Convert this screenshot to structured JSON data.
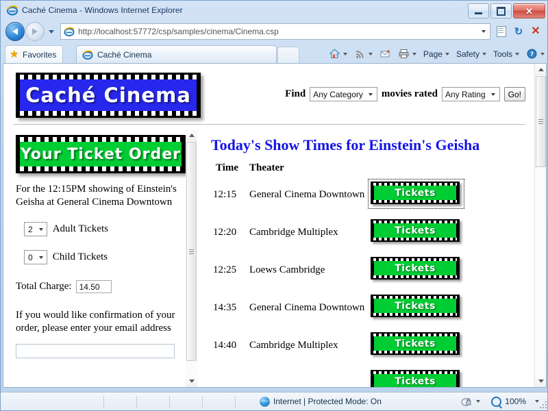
{
  "window": {
    "title": "Caché Cinema - Windows Internet Explorer",
    "minimize_label": "Minimize",
    "maximize_label": "Maximize",
    "close_label": "✕"
  },
  "browser": {
    "back_label": "Back",
    "forward_label": "Forward",
    "recent_pages_label": "Recent Pages",
    "url_scheme": "http://",
    "url_host": "localhost:57772",
    "url_path": "/csp/samples/cinema/Cinema.csp",
    "url_full": "http://localhost:57772/csp/samples/cinema/Cinema.csp",
    "compatibility_label": "Compatibility View",
    "refresh_label": "↻",
    "stop_label": "✕",
    "favorites_label": "Favorites",
    "tab_label": "Caché Cinema",
    "new_tab_label": "New Tab",
    "commands": [
      {
        "label": "Page"
      },
      {
        "label": "Safety"
      },
      {
        "label": "Tools"
      }
    ],
    "home_label": "Home",
    "feeds_label": "Feeds",
    "mail_label": "Read Mail",
    "print_label": "Print",
    "help_label": "Help"
  },
  "site": {
    "logo_text": "Caché Cinema",
    "logo_bg_color": "#2727EE",
    "find": {
      "find_label": "Find",
      "category_value": "Any Category",
      "movies_rated_label": "movies rated",
      "rating_value": "Any Rating",
      "go_label": "Go!"
    }
  },
  "order": {
    "banner_text": "Your Ticket Order",
    "banner_bg_color": "#00CC33",
    "description": "For the 12:15PM showing of Einstein's Geisha at General Cinema Downtown",
    "adult_value": "2",
    "adult_label": "Adult Tickets",
    "child_value": "0",
    "child_label": "Child Tickets",
    "total_label": "Total Charge:",
    "total_value": "14.50",
    "email_note": "If you would like confirmation of your order, please enter your email address",
    "email_value": "",
    "email_placeholder": ""
  },
  "showtimes": {
    "title": "Today's Show Times for Einstein's Geisha",
    "title_color": "#1414E6",
    "col_time": "Time",
    "col_theater": "Theater",
    "tickets_label": "Tickets",
    "rows": [
      {
        "time": "12:15",
        "theater": "General Cinema Downtown",
        "focused": true
      },
      {
        "time": "12:20",
        "theater": "Cambridge Multiplex",
        "focused": false
      },
      {
        "time": "12:25",
        "theater": "Loews Cambridge",
        "focused": false
      },
      {
        "time": "14:35",
        "theater": "General Cinema Downtown",
        "focused": false
      },
      {
        "time": "14:40",
        "theater": "Cambridge Multiplex",
        "focused": false
      },
      {
        "time": "",
        "theater": "",
        "focused": false
      }
    ]
  },
  "statusbar": {
    "zone_text": "Internet | Protected Mode: On",
    "zoom_level": "100%",
    "privacy_label": "Privacy Report"
  }
}
